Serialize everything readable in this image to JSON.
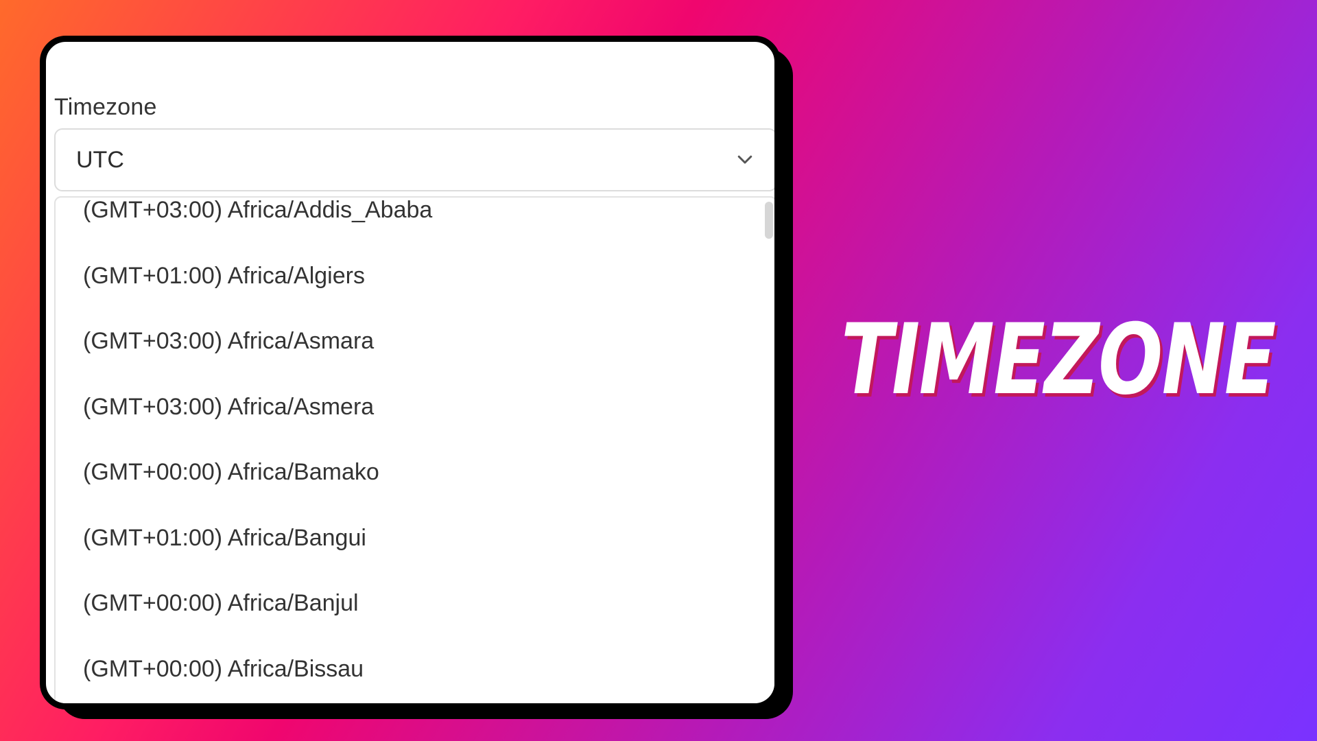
{
  "timezone_field": {
    "label": "Timezone",
    "selected_value": "UTC",
    "chevron_icon": "chevron-down-icon",
    "options": [
      "(GMT+03:00) Africa/Addis_Ababa",
      "(GMT+01:00) Africa/Algiers",
      "(GMT+03:00) Africa/Asmara",
      "(GMT+03:00) Africa/Asmera",
      "(GMT+00:00) Africa/Bamako",
      "(GMT+01:00) Africa/Bangui",
      "(GMT+00:00) Africa/Banjul",
      "(GMT+00:00) Africa/Bissau"
    ]
  },
  "headline": "TIMEZONE",
  "colors": {
    "gradient_start": "#ff6a2b",
    "gradient_mid": "#f0066e",
    "gradient_end": "#7a32ff",
    "headline_text": "#ffffff",
    "headline_shadow": "#c2185b"
  }
}
